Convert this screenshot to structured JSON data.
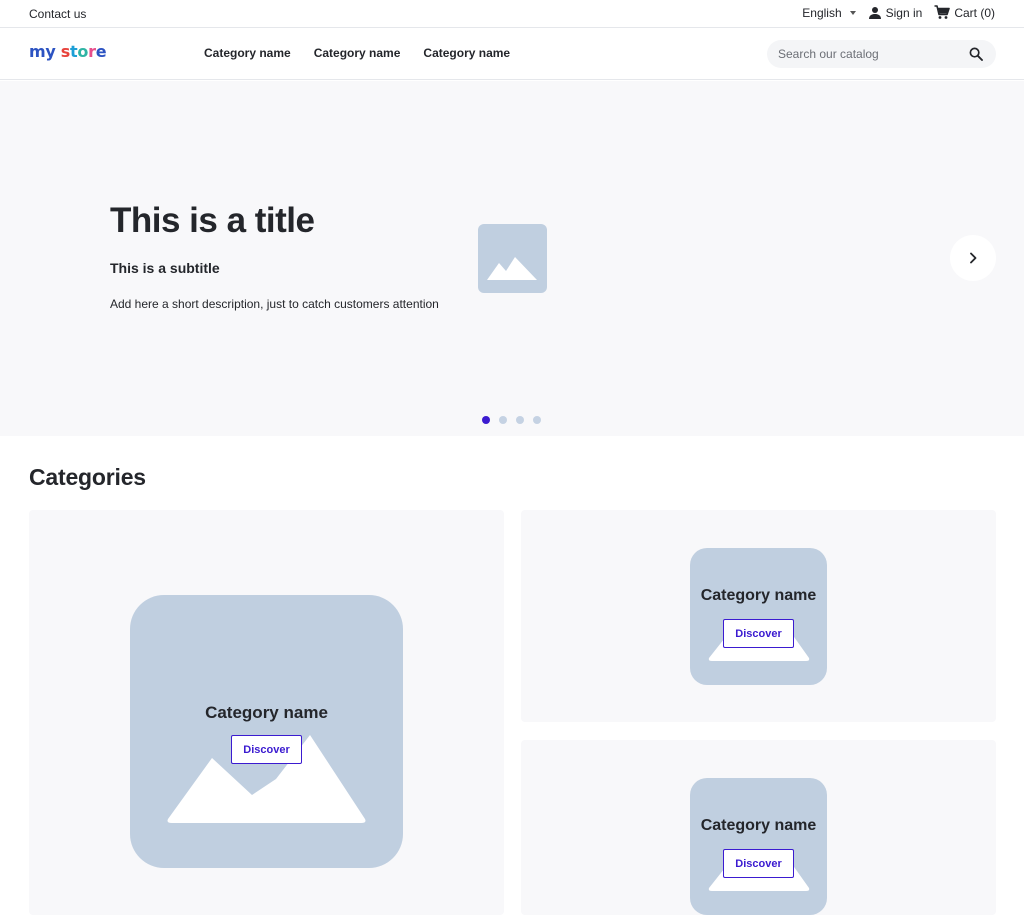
{
  "topbar": {
    "contact_label": "Contact us",
    "language_label": "English",
    "sign_in_label": "Sign in",
    "cart_label": "Cart (0)"
  },
  "header": {
    "logo": {
      "part1": "my",
      "part2": "store"
    },
    "nav": [
      {
        "label": "Category name"
      },
      {
        "label": "Category name"
      },
      {
        "label": "Category name"
      }
    ],
    "search": {
      "placeholder": "Search our catalog",
      "value": ""
    }
  },
  "hero": {
    "title": "This is a title",
    "subtitle": "This is a subtitle",
    "description": "Add here a short description, just to catch customers attention",
    "slide_count": 4,
    "active_slide": 1
  },
  "categories": {
    "heading": "Categories",
    "items": [
      {
        "name": "Category name",
        "button": "Discover"
      },
      {
        "name": "Category name",
        "button": "Discover"
      },
      {
        "name": "Category name",
        "button": "Discover"
      }
    ]
  },
  "colors": {
    "accent": "#3b1bd0",
    "placeholder_image": "#c0cfe0",
    "hero_background": "#f8f8fa",
    "text": "#24262b"
  },
  "icons": {
    "language_caret": "chevron-down-icon",
    "sign_in": "user-icon",
    "cart": "cart-icon",
    "search": "search-icon",
    "next": "chevron-right-icon",
    "image_placeholder": "image-icon"
  }
}
